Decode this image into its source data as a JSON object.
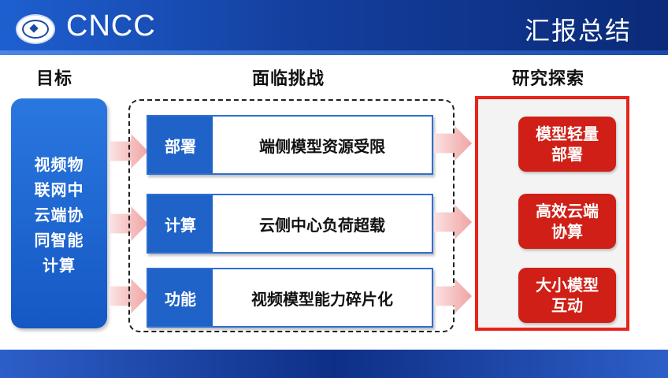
{
  "header": {
    "logo_text": "CNCC",
    "title": "汇报总结"
  },
  "columns": {
    "goal_heading": "目标",
    "challenge_heading": "面临挑战",
    "research_heading": "研究探索"
  },
  "goal": {
    "lines": [
      "视频物",
      "联网中",
      "云端协",
      "同智能",
      "计算"
    ]
  },
  "challenges": [
    {
      "tag": "部署",
      "desc": "端侧模型资源受限"
    },
    {
      "tag": "计算",
      "desc": "云侧中心负荷超载"
    },
    {
      "tag": "功能",
      "desc": "视频模型能力碎片化"
    }
  ],
  "research": [
    {
      "line1": "模型轻量",
      "line2": "部署"
    },
    {
      "line1": "高效云端",
      "line2": "协算"
    },
    {
      "line1": "大小模型",
      "line2": "互动"
    }
  ],
  "colors": {
    "header_blue": "#1e5fd0",
    "goal_blue": "#1f63c8",
    "research_red": "#cf1f16",
    "panel_border_red": "#e8231b",
    "arrow_pink": "#f0a4a4"
  }
}
